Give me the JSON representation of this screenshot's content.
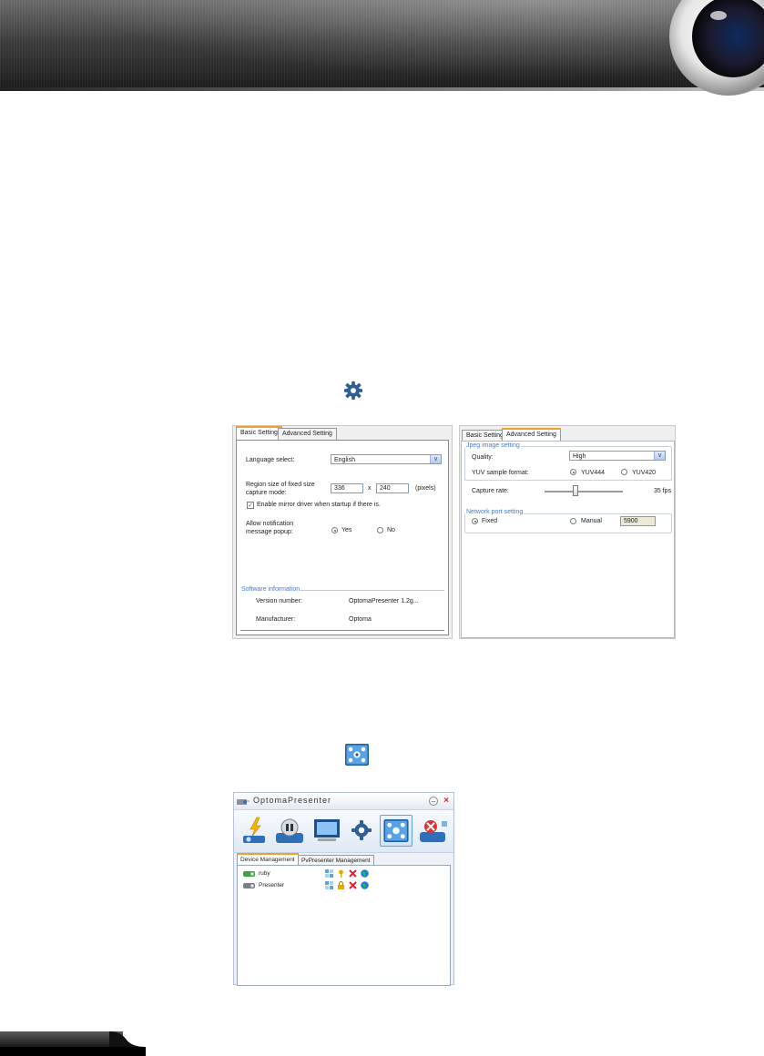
{
  "settings_left": {
    "tabs": [
      "Basic Setting",
      "Advanced Setting"
    ],
    "language_label": "Language select:",
    "language_value": "English",
    "region_label_1": "Region size of fixed size",
    "region_label_2": "capture mode:",
    "region_width": "336",
    "region_x": "x",
    "region_height": "240",
    "region_unit": "(pixels)",
    "mirror_driver_label": "Enable mirror driver when startup if there is.",
    "notification_label_1": "Allow notification",
    "notification_label_2": "message popup:",
    "yes_label": "Yes",
    "no_label": "No",
    "software_info_legend": "Software information",
    "version_label": "Version number:",
    "version_value": "OptomaPresenter 1.2g...",
    "manufacturer_label": "Manufacturer:",
    "manufacturer_value": "Optoma"
  },
  "settings_right": {
    "tabs": [
      "Basic Setting",
      "Advanced Setting"
    ],
    "jpeg_legend": "Jpeg image setting",
    "quality_label": "Quality:",
    "quality_value": "High",
    "yuv_label": "YUV sample format:",
    "yuv444": "YUV444",
    "yuv420": "YUV420",
    "capture_rate_label": "Capture rate:",
    "capture_rate_value": "35 fps",
    "capture_rate_level": 0.4,
    "network_legend": "Network port setting",
    "fixed_label": "Fixed",
    "manual_label": "Manual",
    "port_value": "5900"
  },
  "presenter": {
    "title": "OptomaPresenter",
    "tabs": [
      "Device Management",
      "PvPresenter Management"
    ],
    "devices": [
      "ruby",
      "Presenter"
    ]
  },
  "colors": {
    "accent_orange": "#f0a030",
    "legend_blue": "#4a7ac8"
  }
}
